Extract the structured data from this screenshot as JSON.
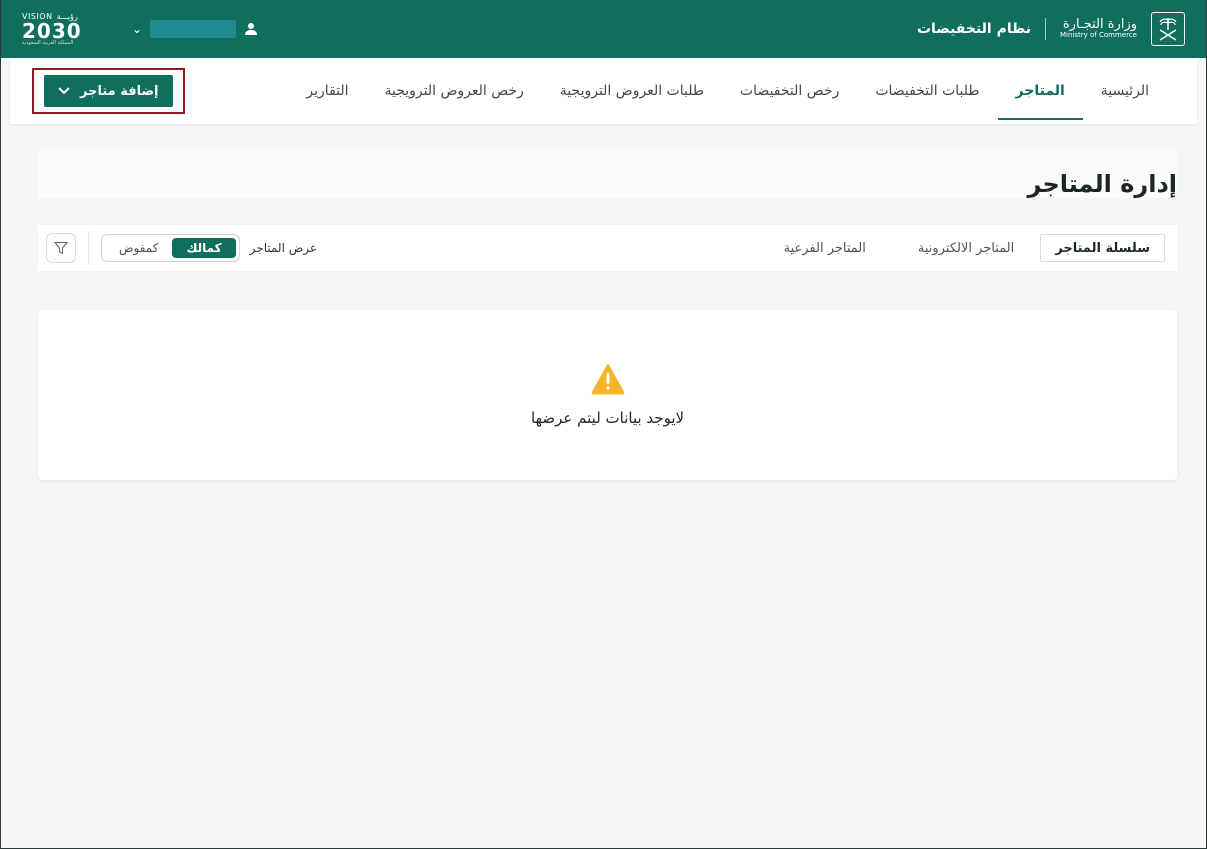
{
  "header": {
    "vision_top": "VISION",
    "vision_top_ar": "رؤيـــة",
    "vision_number": "2030",
    "vision_sub": "المملكة العربية السعودية",
    "ministry_ar": "وزارة التجـارة",
    "ministry_en": "Ministry of Commerce",
    "system_name": "نظام التخفيضات"
  },
  "nav": {
    "items": [
      {
        "label": "الرئيسية"
      },
      {
        "label": "المتاجر"
      },
      {
        "label": "طلبات التخفيضات"
      },
      {
        "label": "رخص التخفيضات"
      },
      {
        "label": "طلبات العروض الترويجية"
      },
      {
        "label": "رخص العروض الترويجية"
      },
      {
        "label": "التقارير"
      }
    ],
    "add_store_label": "إضافة متاجر"
  },
  "page": {
    "title": "إدارة المتاجر"
  },
  "toolbar": {
    "tabs": [
      {
        "label": "سلسلة المتاجر"
      },
      {
        "label": "المتاجر الالكترونية"
      },
      {
        "label": "المتاجر الفرعية"
      }
    ],
    "view_label": "عرض المتاجر",
    "toggle_owner": "كمالك",
    "toggle_delegate": "كمفوض"
  },
  "empty_state": {
    "message": "لايوجد بيانات ليتم عرضها"
  },
  "colors": {
    "primary": "#0f6e5d",
    "warning": "#f5b529",
    "highlight_border": "#8a1c1c"
  },
  "icons": [
    "chevron-down-icon",
    "user-icon",
    "emblem-icon",
    "filter-icon",
    "warning-icon"
  ]
}
